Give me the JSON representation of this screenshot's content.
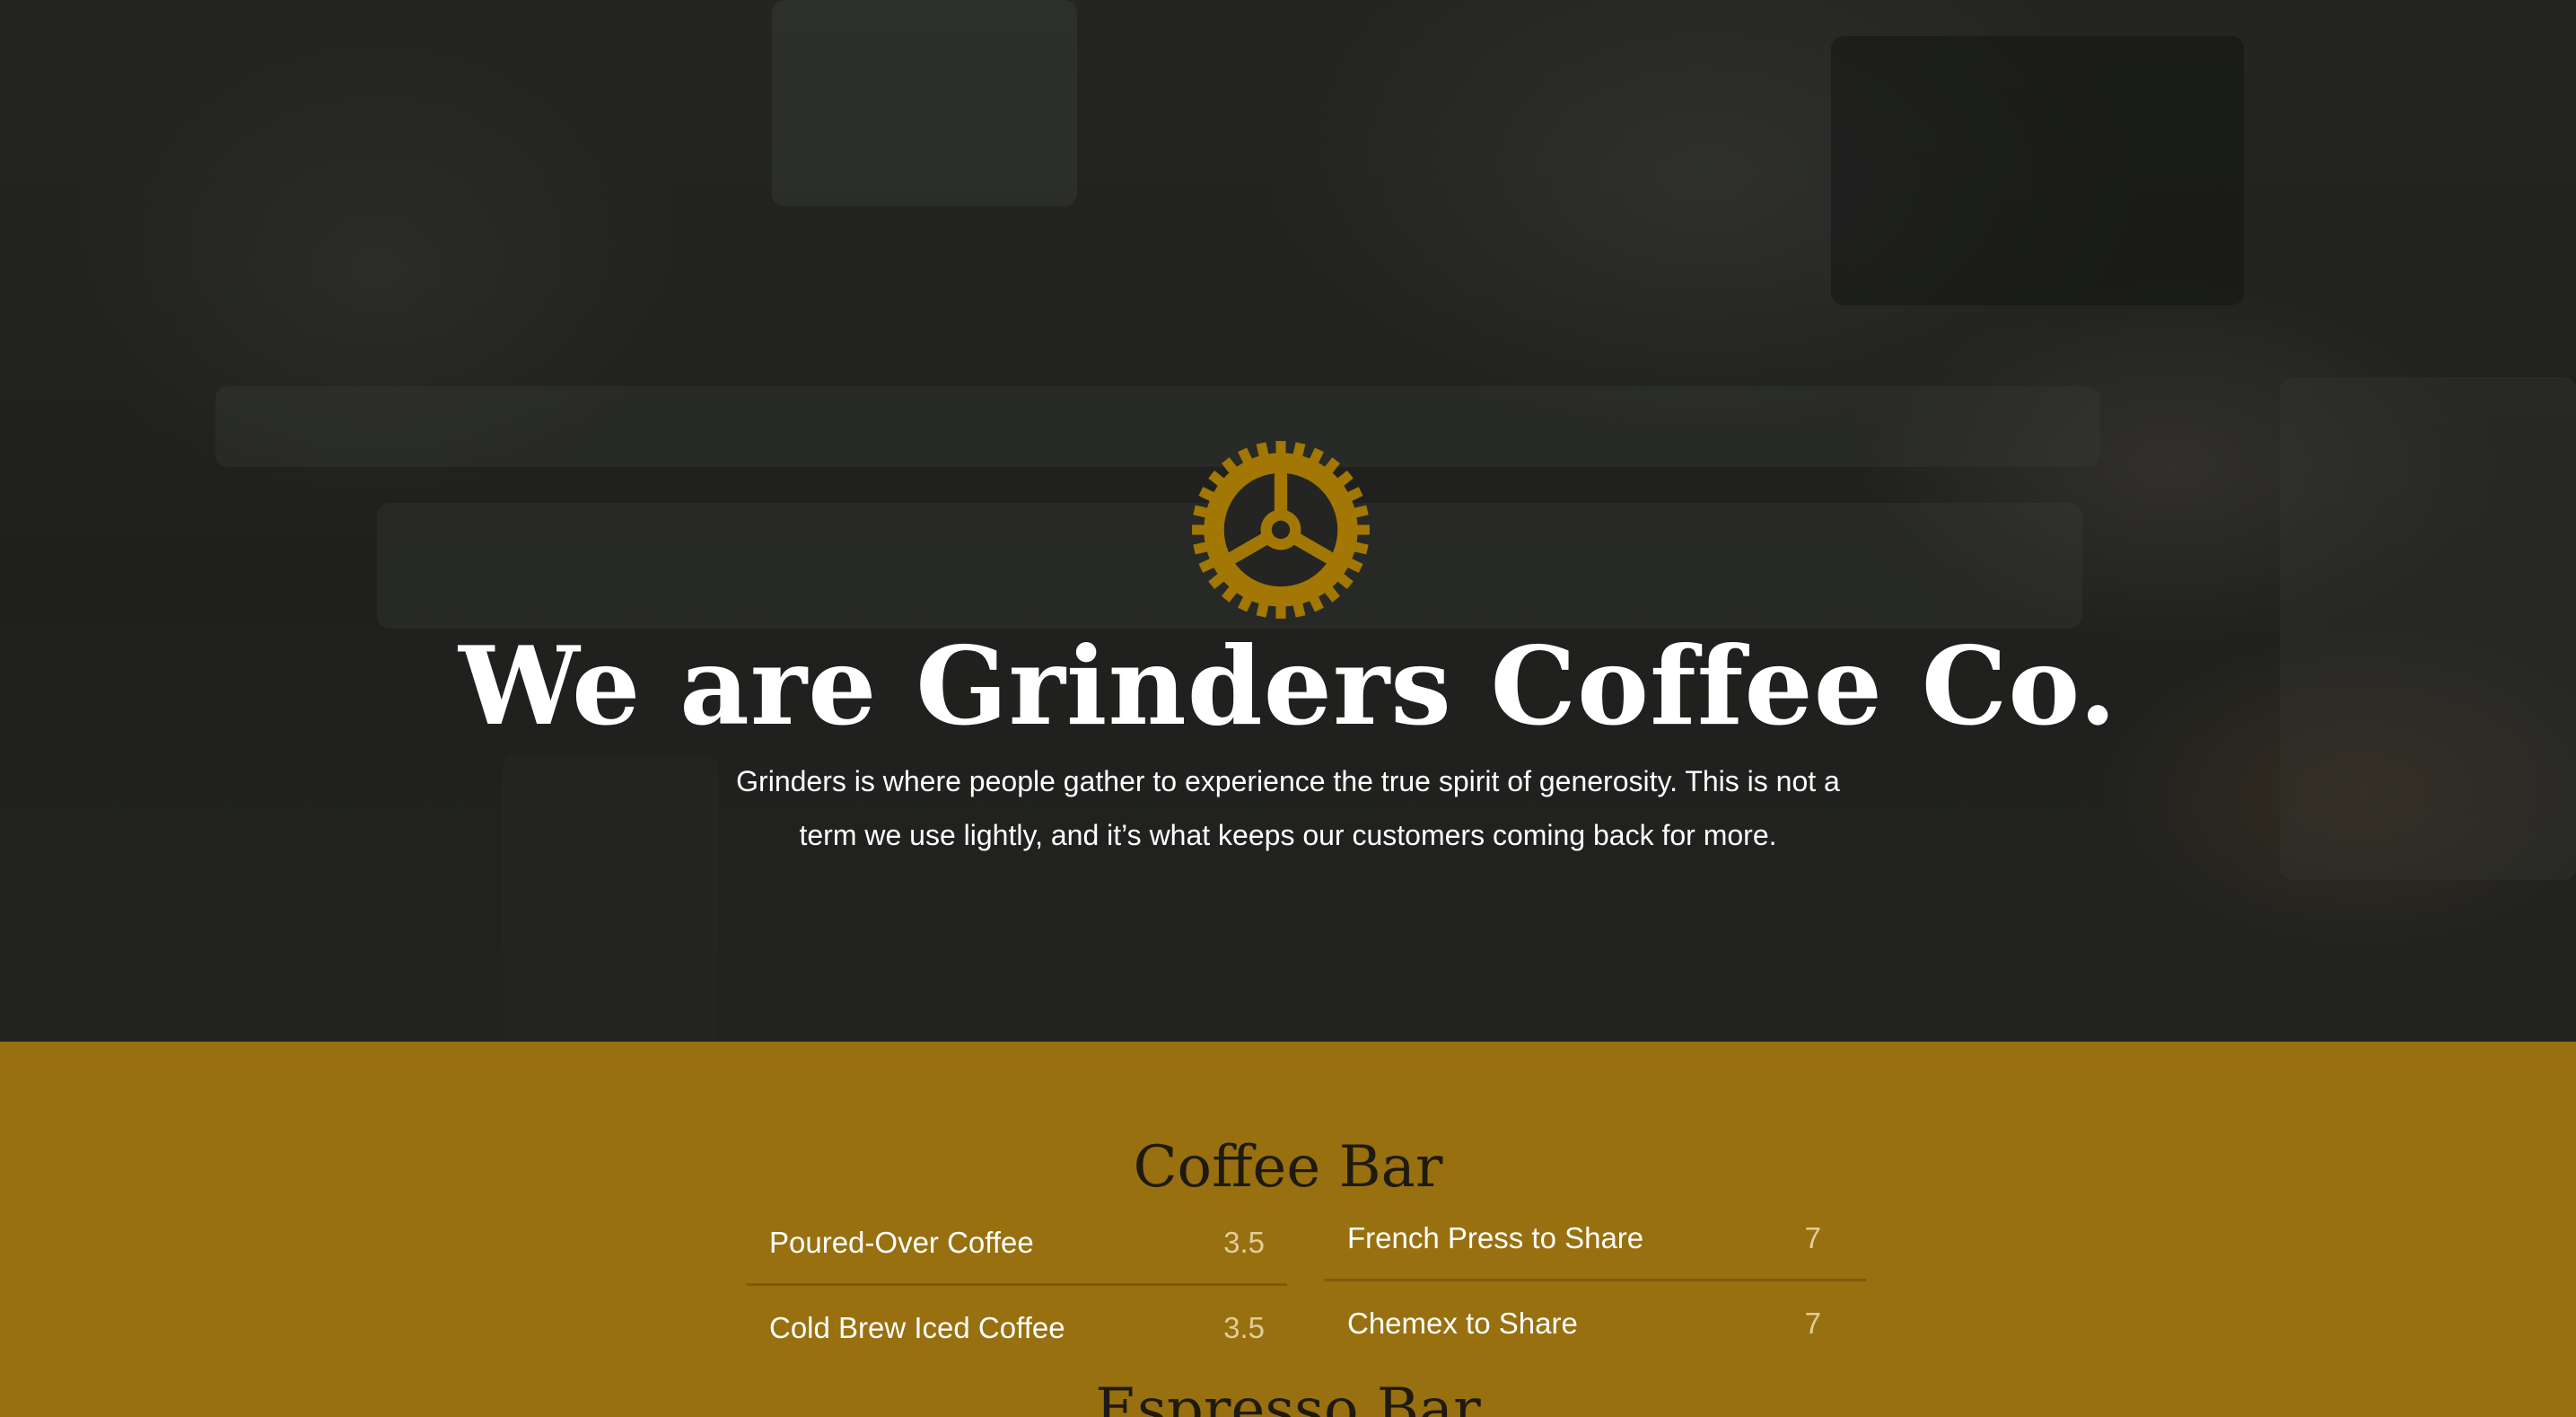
{
  "colors": {
    "accent": "#a27704",
    "menu_bg": "#98700f",
    "hero_overlay": "#1f201e",
    "heading_dark": "#1e1a10",
    "price": "#e2cc9a"
  },
  "hero": {
    "logo_icon": "gear-icon",
    "title": "We are Grinders Coffee Co.",
    "subtitle": "Grinders is where people gather to experience the true spirit of generosity. This is not a term we use lightly, and it’s what keeps our customers coming back for more."
  },
  "menu": {
    "coffee_bar": {
      "title": "Coffee Bar",
      "left_items": [
        {
          "name": "Poured-Over Coffee",
          "price": "3.5"
        },
        {
          "name": "Cold Brew Iced Coffee",
          "price": "3.5"
        }
      ],
      "right_items": [
        {
          "name": "French Press to Share",
          "price": "7"
        },
        {
          "name": "Chemex to Share",
          "price": "7"
        }
      ]
    },
    "espresso_bar": {
      "title": "Espresso Bar"
    }
  }
}
